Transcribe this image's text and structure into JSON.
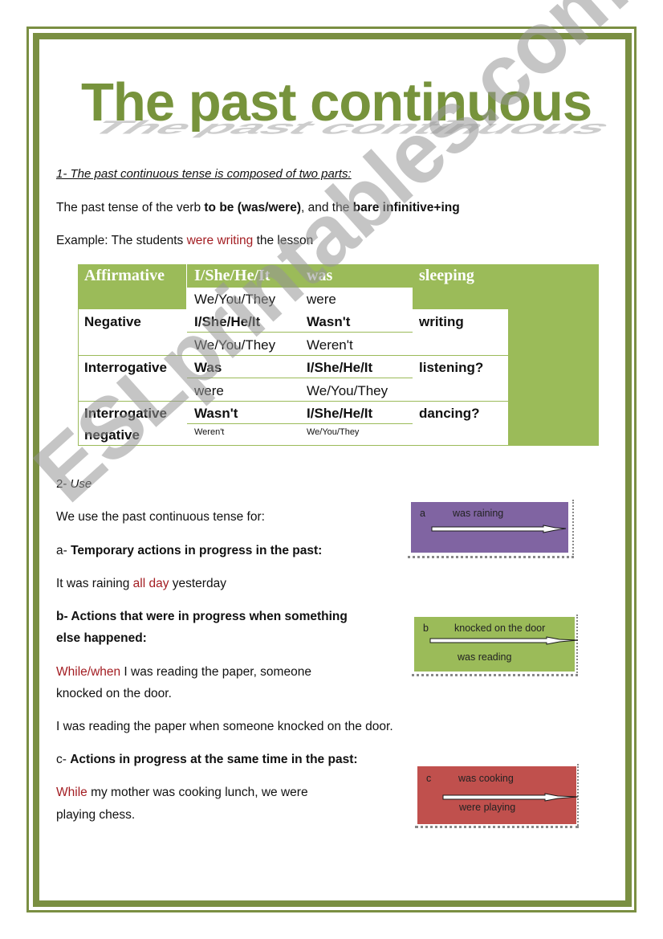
{
  "document": {
    "title": "The past continuous",
    "watermark": "ESLprintables.com",
    "colors": {
      "border_green": "#7a8f42",
      "title_green": "#77933c",
      "table_green": "#9bbb59",
      "highlight_red": "#a31d22",
      "box_a_purple": "#8064a2",
      "box_b_green": "#9bbb59",
      "box_c_red": "#c0504d"
    }
  },
  "section1": {
    "heading": "1- The past continuous tense is composed of two parts:",
    "line1": {
      "part1": "The past tense of the verb ",
      "bold1": "to be (was/were)",
      "part2": ", and the ",
      "bold2": "bare infinitive+ing"
    },
    "example": {
      "prefix": "Example: The students ",
      "highlight": "were writing",
      "suffix": " the lesson"
    }
  },
  "table": {
    "rows": [
      {
        "label": "Affirmative",
        "c1a": "I/She/He/It",
        "c2a": "was",
        "c1b": "We/You/They",
        "c2b": "were",
        "verb": "sleeping"
      },
      {
        "label": "Negative",
        "c1a": "I/She/He/It",
        "c2a": "Wasn't",
        "c1b": "We/You/They",
        "c2b": "Weren't",
        "verb": "writing"
      },
      {
        "label": "Interrogative",
        "c1a": "Was",
        "c2a": "I/She/He/It",
        "c1b": "were",
        "c2b": "We/You/They",
        "verb": "listening?"
      },
      {
        "label_line1": "Interrogative",
        "label_line2": "negative",
        "c1a": "Wasn't",
        "c2a": "I/She/He/It",
        "c1b": "Weren't",
        "c2b": "We/You/They",
        "verb": "dancing?"
      }
    ]
  },
  "section2": {
    "heading_num": "2- ",
    "heading_text": "Use",
    "intro": "We use the past continuous tense for:",
    "a": {
      "title_prefix": "a-  ",
      "title": "Temporary actions in progress in the past:",
      "example_prefix": "It was raining ",
      "example_highlight": "all day",
      "example_suffix": " yesterday",
      "diagram": {
        "letter": "a",
        "top_label": "was raining"
      }
    },
    "b": {
      "title_line1": "b- Actions that were in progress when something",
      "title_line2": "else happened:",
      "example1_highlight": "While/when",
      "example1_line1": " I was reading the paper, someone",
      "example1_line2": "knocked on the door.",
      "example2": "I was reading the paper when someone knocked on the door.",
      "diagram": {
        "letter": "b",
        "top_label": "knocked on the door",
        "bottom_label": "was reading"
      }
    },
    "c": {
      "title_prefix": "c- ",
      "title": "Actions in progress at the same time in the past:",
      "example_highlight": "While",
      "example_line1": " my mother was cooking lunch, we were",
      "example_line2": "playing chess.",
      "diagram": {
        "letter": "c",
        "top_label": "was cooking",
        "bottom_label": "were playing"
      }
    }
  }
}
